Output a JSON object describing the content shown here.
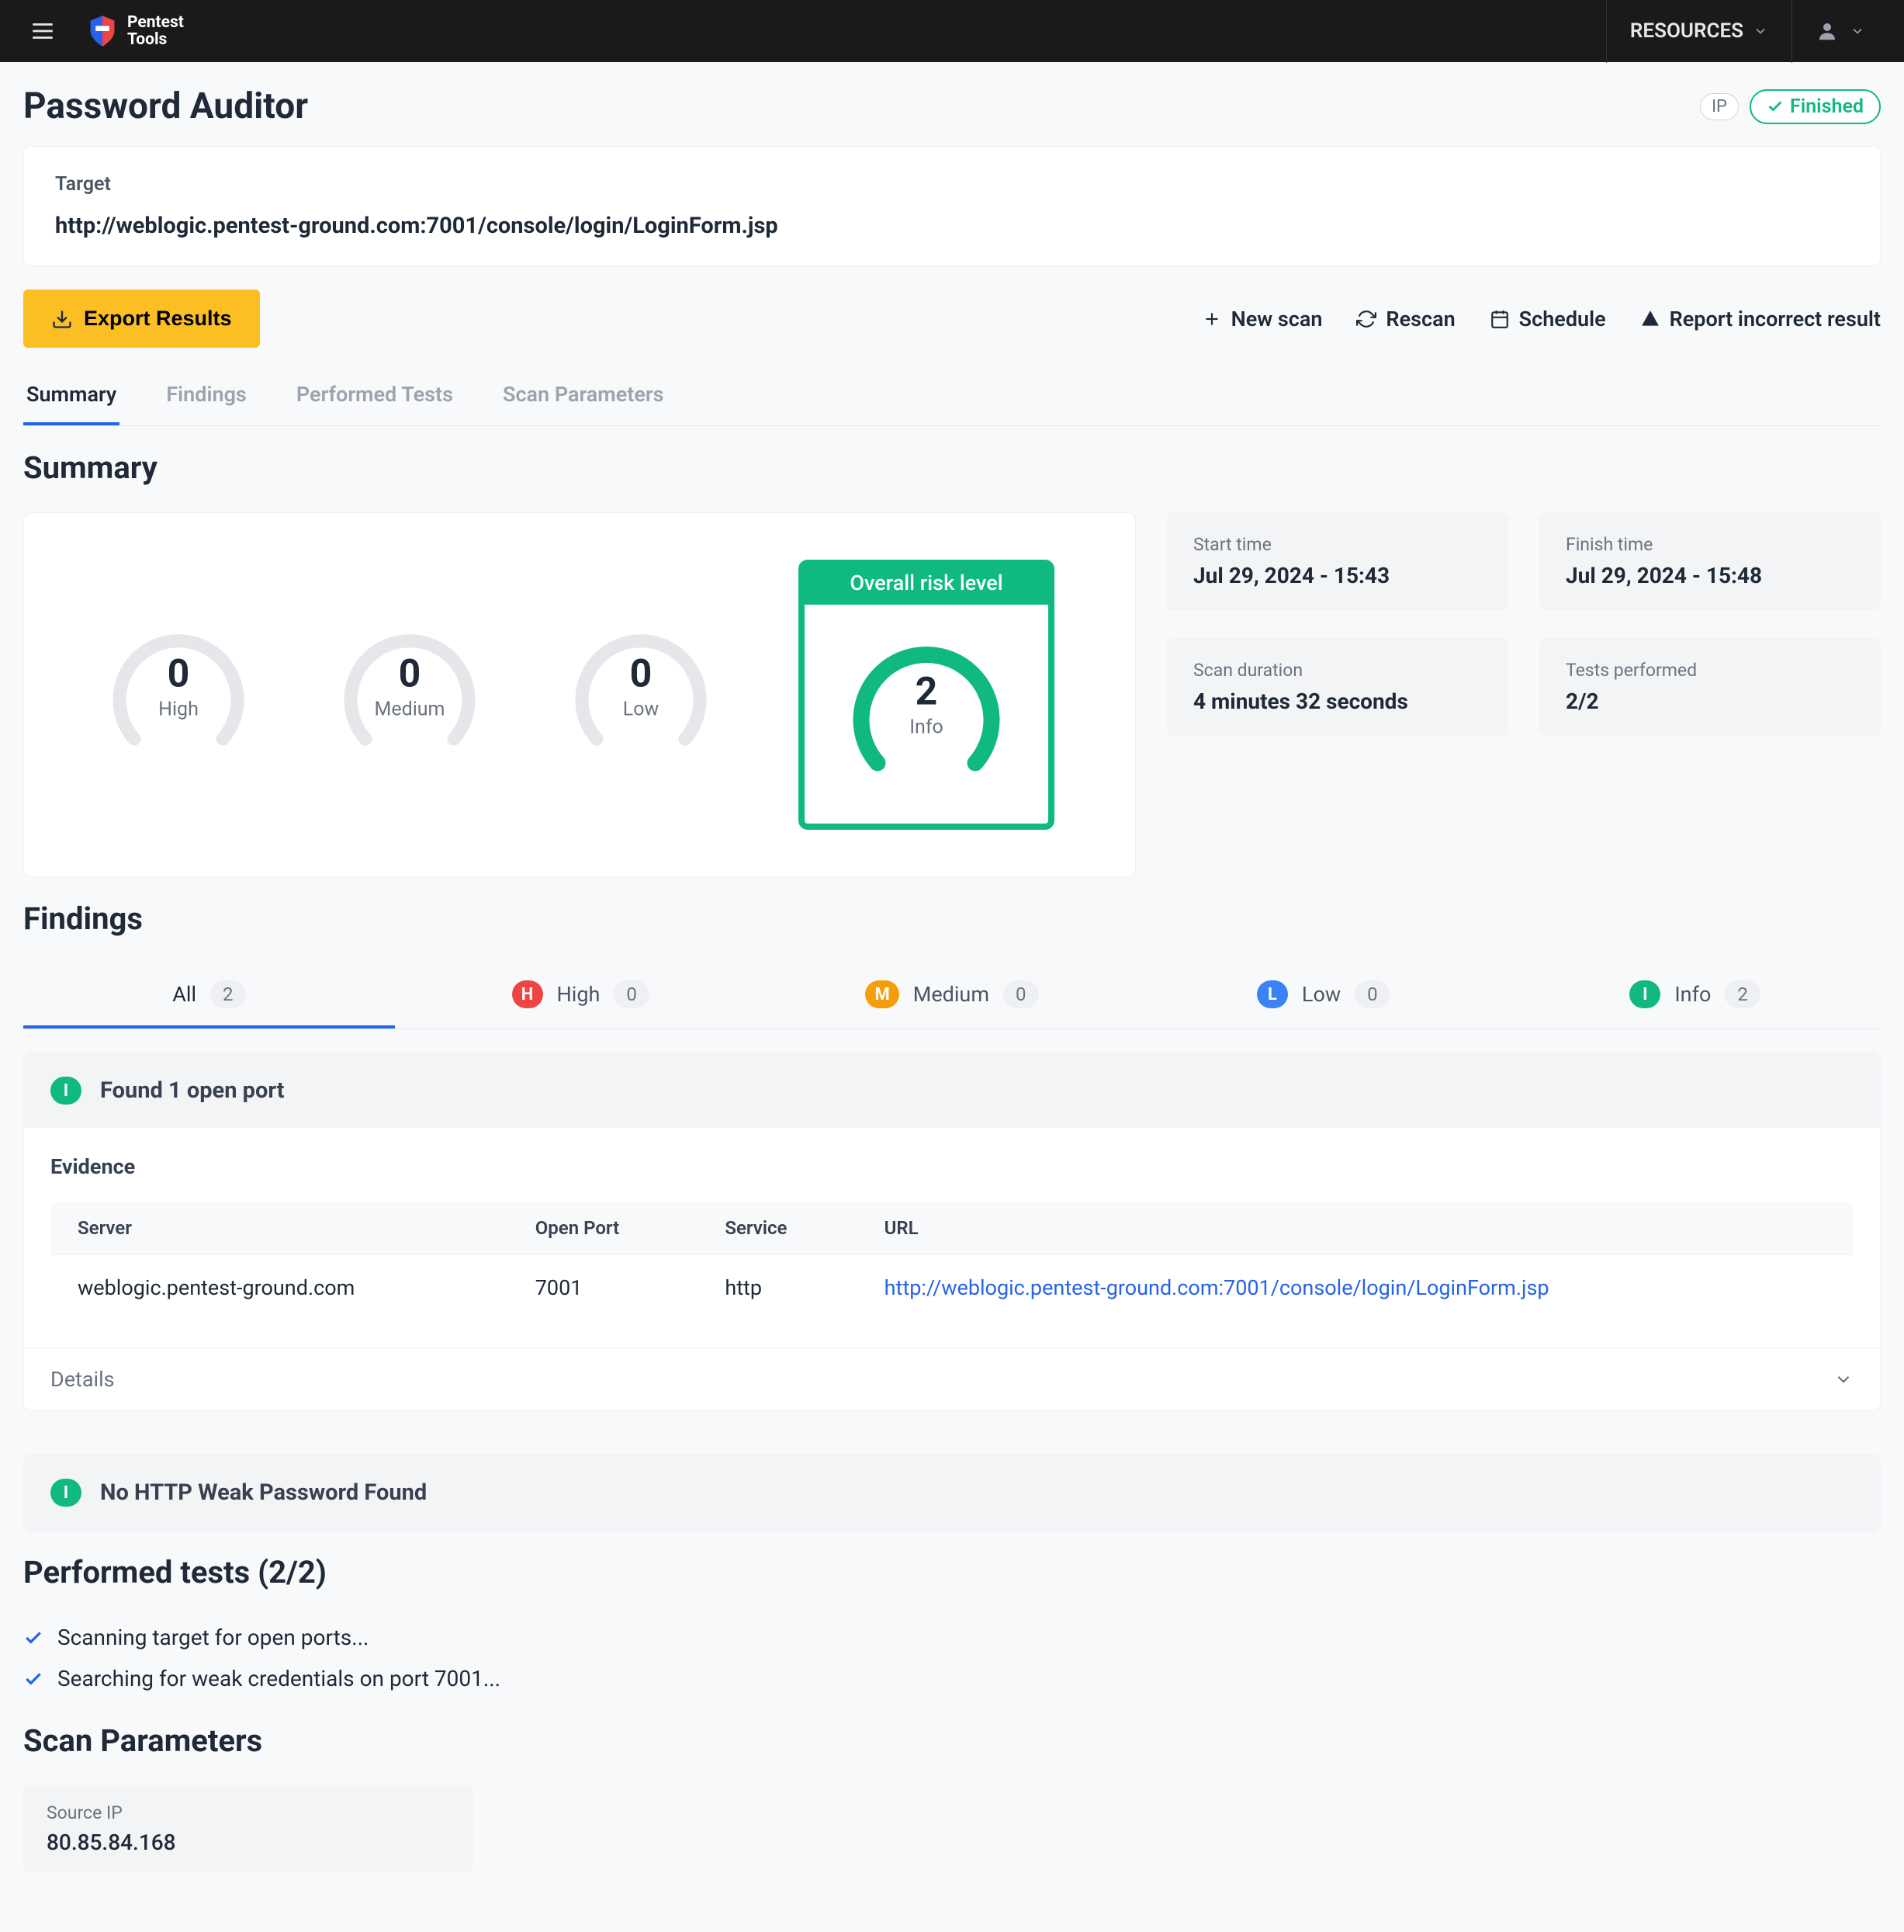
{
  "topbar": {
    "resources_label": "RESOURCES",
    "logo_line1": "Pentest",
    "logo_line2": "Tools"
  },
  "page": {
    "title": "Password Auditor",
    "ip_badge": "IP",
    "status_label": "Finished"
  },
  "target": {
    "label": "Target",
    "value": "http://weblogic.pentest-ground.com:7001/console/login/LoginForm.jsp"
  },
  "toolbar": {
    "export_label": "Export Results",
    "new_scan": "New scan",
    "rescan": "Rescan",
    "schedule": "Schedule",
    "report": "Report incorrect result"
  },
  "tabs": {
    "summary": "Summary",
    "findings": "Findings",
    "performed": "Performed Tests",
    "params": "Scan Parameters"
  },
  "summary": {
    "heading": "Summary",
    "gauges": {
      "high": {
        "count": "0",
        "label": "High"
      },
      "medium": {
        "count": "0",
        "label": "Medium"
      },
      "low": {
        "count": "0",
        "label": "Low"
      },
      "info": {
        "count": "2",
        "label": "Info"
      }
    },
    "risk_header": "Overall risk level",
    "metrics": {
      "start_label": "Start time",
      "start_value": "Jul 29, 2024 - 15:43",
      "finish_label": "Finish time",
      "finish_value": "Jul 29, 2024 - 15:48",
      "duration_label": "Scan duration",
      "duration_value": "4 minutes 32 seconds",
      "tests_label": "Tests performed",
      "tests_value": "2/2"
    }
  },
  "findings": {
    "heading": "Findings",
    "filters": {
      "all": {
        "label": "All",
        "count": "2"
      },
      "high": {
        "label": "High",
        "count": "0"
      },
      "medium": {
        "label": "Medium",
        "count": "0"
      },
      "low": {
        "label": "Low",
        "count": "0"
      },
      "info": {
        "label": "Info",
        "count": "2"
      }
    },
    "item1": {
      "title": "Found 1 open port",
      "evidence_label": "Evidence",
      "columns": {
        "c1": "Server",
        "c2": "Open Port",
        "c3": "Service",
        "c4": "URL"
      },
      "row": {
        "server": "weblogic.pentest-ground.com",
        "port": "7001",
        "service": "http",
        "url": "http://weblogic.pentest-ground.com:7001/console/login/LoginForm.jsp"
      },
      "details_label": "Details"
    },
    "item2": {
      "title": "No HTTP Weak Password Found"
    }
  },
  "performed": {
    "heading": "Performed tests (2/2)",
    "t1": "Scanning target for open ports...",
    "t2": "Searching for weak credentials on port 7001..."
  },
  "params": {
    "heading": "Scan Parameters",
    "source_ip_label": "Source IP",
    "source_ip_value": "80.85.84.168"
  }
}
